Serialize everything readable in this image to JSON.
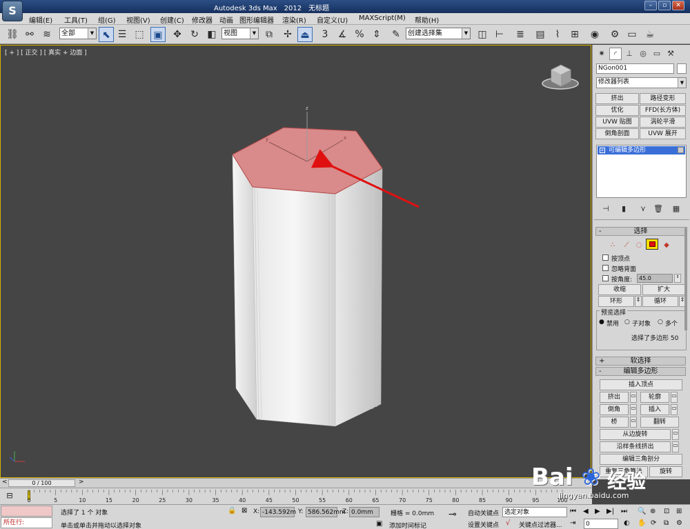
{
  "app": {
    "title_name": "Autodesk 3ds Max",
    "title_version": "2012",
    "title_doc": "无标题",
    "logo_text": "S"
  },
  "menu": [
    "编辑(E)",
    "工具(T)",
    "组(G)",
    "视图(V)",
    "创建(C)",
    "修改器",
    "动画",
    "图形编辑器",
    "渲染(R)",
    "自定义(U)",
    "MAXScript(M)",
    "帮助(H)"
  ],
  "toolbar": {
    "filter_select": "全部",
    "view_select": "视图",
    "selection_set": "创建选择集",
    "snap_label": "3"
  },
  "viewport": {
    "label": "[ + ] [ 正交 ] [ 真实 + 边面 ]",
    "gizmo_axes": {
      "z": "z",
      "x": "x",
      "y": "y"
    }
  },
  "command_panel": {
    "object_name": "NGon001",
    "modifier_list": "修改器列表",
    "modifier_buttons": [
      "挤出",
      "路径变形",
      "优化",
      "FFD(长方体)",
      "UVW 贴图",
      "涡轮平滑",
      "倒角剖面",
      "UVW 展开"
    ],
    "stack_item": "可编辑多边形",
    "selection": {
      "title": "选择",
      "by_vertex": "按顶点",
      "ignore_backfacing": "忽略背面",
      "by_angle": "按角度:",
      "angle_value": "45.0",
      "shrink": "收缩",
      "grow": "扩大",
      "ring": "环形",
      "loop": "循环",
      "preview_title": "预览选择",
      "preview_off": "禁用",
      "preview_subobject": "子对象",
      "preview_multi": "多个",
      "status": "选择了多边形 50"
    },
    "soft_selection": "软选择",
    "edit_polygons": {
      "title": "编辑多边形",
      "insert_vertex": "插入顶点",
      "extrude": "挤出",
      "outline": "轮廓",
      "bevel": "倒角",
      "inset": "插入",
      "bridge": "桥",
      "flip": "翻转",
      "hinge": "从边旋转",
      "extrude_along_spline": "沿样条线挤出",
      "edit_triangulation": "编辑三角剖分",
      "retriangulate": "重复三角算法",
      "turn": "旋转"
    }
  },
  "timeline": {
    "frame": "0 / 100",
    "ticks": [
      "0",
      "5",
      "10",
      "15",
      "20",
      "25",
      "30",
      "35",
      "40",
      "45",
      "50",
      "55",
      "60",
      "65",
      "70",
      "75",
      "80",
      "85",
      "90",
      "95",
      "100"
    ]
  },
  "status": {
    "mini_listener": "所在行:",
    "selected": "选择了 1 个 对象",
    "prompt": "单击或单击并拖动以选择对象",
    "x_label": "X:",
    "x_value": "-143.592m",
    "y_label": "Y:",
    "y_value": "586.562mm",
    "z_label": "Z:",
    "z_value": "0.0mm",
    "grid": "栅格 = 0.0mm",
    "auto_key": "自动关键点",
    "set_key": "设置关键点",
    "selected_obj": "选定对象",
    "key_filters": "关键点过滤器...",
    "add_time_tag": "添加时间标记",
    "frame_value": "0"
  },
  "watermark": {
    "brand": "Bai",
    "brand2": "经验",
    "url": "jingyan.baidu.com"
  },
  "colors": {
    "selected_face": "#d98a8a",
    "arrow": "#e01010",
    "viewport_border": "#d6b400",
    "active_stack": "#3a6fd8"
  }
}
